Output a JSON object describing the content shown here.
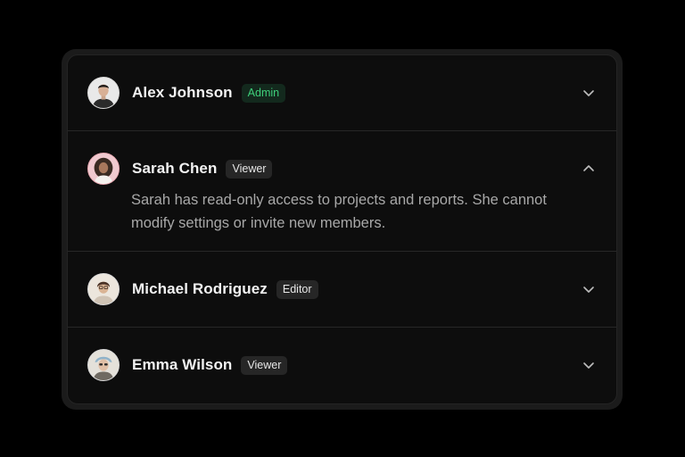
{
  "members": [
    {
      "name": "Alex Johnson",
      "role": "Admin",
      "role_color": "#3ecf7a",
      "expanded": false,
      "avatar_icon": "avatar-alex-johnson",
      "chevron_icon": "chevron-down-icon"
    },
    {
      "name": "Sarah Chen",
      "role": "Viewer",
      "expanded": true,
      "description": "Sarah has read-only access to projects and reports. She cannot modify settings or invite new members.",
      "avatar_icon": "avatar-sarah-chen",
      "chevron_icon": "chevron-up-icon"
    },
    {
      "name": "Michael Rodriguez",
      "role": "Editor",
      "expanded": false,
      "avatar_icon": "avatar-michael-rodriguez",
      "chevron_icon": "chevron-down-icon"
    },
    {
      "name": "Emma Wilson",
      "role": "Viewer",
      "expanded": false,
      "avatar_icon": "avatar-emma-wilson",
      "chevron_icon": "chevron-down-icon"
    }
  ],
  "colors": {
    "background": "#000000",
    "panel": "#0d0d0d",
    "admin_badge_bg": "#13291d",
    "admin_badge_text": "#3ecf7a"
  }
}
